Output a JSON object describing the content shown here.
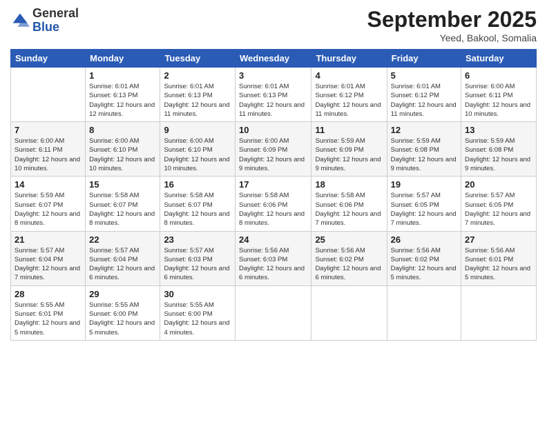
{
  "logo": {
    "general": "General",
    "blue": "Blue"
  },
  "header": {
    "title": "September 2025",
    "subtitle": "Yeed, Bakool, Somalia"
  },
  "weekdays": [
    "Sunday",
    "Monday",
    "Tuesday",
    "Wednesday",
    "Thursday",
    "Friday",
    "Saturday"
  ],
  "weeks": [
    [
      {
        "day": "",
        "info": ""
      },
      {
        "day": "1",
        "info": "Sunrise: 6:01 AM\nSunset: 6:13 PM\nDaylight: 12 hours\nand 12 minutes."
      },
      {
        "day": "2",
        "info": "Sunrise: 6:01 AM\nSunset: 6:13 PM\nDaylight: 12 hours\nand 11 minutes."
      },
      {
        "day": "3",
        "info": "Sunrise: 6:01 AM\nSunset: 6:13 PM\nDaylight: 12 hours\nand 11 minutes."
      },
      {
        "day": "4",
        "info": "Sunrise: 6:01 AM\nSunset: 6:12 PM\nDaylight: 12 hours\nand 11 minutes."
      },
      {
        "day": "5",
        "info": "Sunrise: 6:01 AM\nSunset: 6:12 PM\nDaylight: 12 hours\nand 11 minutes."
      },
      {
        "day": "6",
        "info": "Sunrise: 6:00 AM\nSunset: 6:11 PM\nDaylight: 12 hours\nand 10 minutes."
      }
    ],
    [
      {
        "day": "7",
        "info": "Sunrise: 6:00 AM\nSunset: 6:11 PM\nDaylight: 12 hours\nand 10 minutes."
      },
      {
        "day": "8",
        "info": "Sunrise: 6:00 AM\nSunset: 6:10 PM\nDaylight: 12 hours\nand 10 minutes."
      },
      {
        "day": "9",
        "info": "Sunrise: 6:00 AM\nSunset: 6:10 PM\nDaylight: 12 hours\nand 10 minutes."
      },
      {
        "day": "10",
        "info": "Sunrise: 6:00 AM\nSunset: 6:09 PM\nDaylight: 12 hours\nand 9 minutes."
      },
      {
        "day": "11",
        "info": "Sunrise: 5:59 AM\nSunset: 6:09 PM\nDaylight: 12 hours\nand 9 minutes."
      },
      {
        "day": "12",
        "info": "Sunrise: 5:59 AM\nSunset: 6:08 PM\nDaylight: 12 hours\nand 9 minutes."
      },
      {
        "day": "13",
        "info": "Sunrise: 5:59 AM\nSunset: 6:08 PM\nDaylight: 12 hours\nand 9 minutes."
      }
    ],
    [
      {
        "day": "14",
        "info": "Sunrise: 5:59 AM\nSunset: 6:07 PM\nDaylight: 12 hours\nand 8 minutes."
      },
      {
        "day": "15",
        "info": "Sunrise: 5:58 AM\nSunset: 6:07 PM\nDaylight: 12 hours\nand 8 minutes."
      },
      {
        "day": "16",
        "info": "Sunrise: 5:58 AM\nSunset: 6:07 PM\nDaylight: 12 hours\nand 8 minutes."
      },
      {
        "day": "17",
        "info": "Sunrise: 5:58 AM\nSunset: 6:06 PM\nDaylight: 12 hours\nand 8 minutes."
      },
      {
        "day": "18",
        "info": "Sunrise: 5:58 AM\nSunset: 6:06 PM\nDaylight: 12 hours\nand 7 minutes."
      },
      {
        "day": "19",
        "info": "Sunrise: 5:57 AM\nSunset: 6:05 PM\nDaylight: 12 hours\nand 7 minutes."
      },
      {
        "day": "20",
        "info": "Sunrise: 5:57 AM\nSunset: 6:05 PM\nDaylight: 12 hours\nand 7 minutes."
      }
    ],
    [
      {
        "day": "21",
        "info": "Sunrise: 5:57 AM\nSunset: 6:04 PM\nDaylight: 12 hours\nand 7 minutes."
      },
      {
        "day": "22",
        "info": "Sunrise: 5:57 AM\nSunset: 6:04 PM\nDaylight: 12 hours\nand 6 minutes."
      },
      {
        "day": "23",
        "info": "Sunrise: 5:57 AM\nSunset: 6:03 PM\nDaylight: 12 hours\nand 6 minutes."
      },
      {
        "day": "24",
        "info": "Sunrise: 5:56 AM\nSunset: 6:03 PM\nDaylight: 12 hours\nand 6 minutes."
      },
      {
        "day": "25",
        "info": "Sunrise: 5:56 AM\nSunset: 6:02 PM\nDaylight: 12 hours\nand 6 minutes."
      },
      {
        "day": "26",
        "info": "Sunrise: 5:56 AM\nSunset: 6:02 PM\nDaylight: 12 hours\nand 5 minutes."
      },
      {
        "day": "27",
        "info": "Sunrise: 5:56 AM\nSunset: 6:01 PM\nDaylight: 12 hours\nand 5 minutes."
      }
    ],
    [
      {
        "day": "28",
        "info": "Sunrise: 5:55 AM\nSunset: 6:01 PM\nDaylight: 12 hours\nand 5 minutes."
      },
      {
        "day": "29",
        "info": "Sunrise: 5:55 AM\nSunset: 6:00 PM\nDaylight: 12 hours\nand 5 minutes."
      },
      {
        "day": "30",
        "info": "Sunrise: 5:55 AM\nSunset: 6:00 PM\nDaylight: 12 hours\nand 4 minutes."
      },
      {
        "day": "",
        "info": ""
      },
      {
        "day": "",
        "info": ""
      },
      {
        "day": "",
        "info": ""
      },
      {
        "day": "",
        "info": ""
      }
    ]
  ]
}
